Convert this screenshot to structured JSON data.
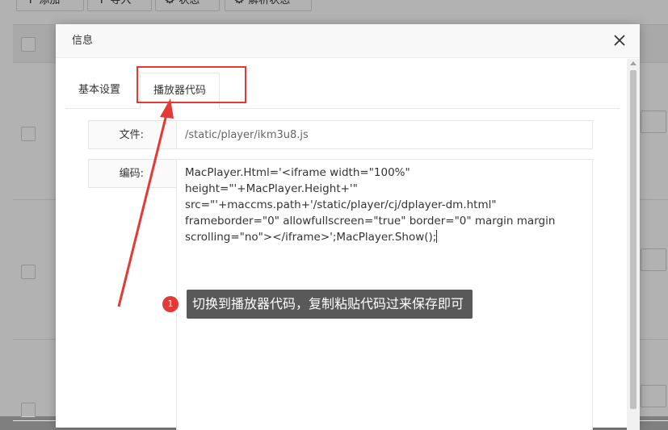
{
  "background": {
    "toolbar": [
      {
        "icon": "plus-icon",
        "label": "添加"
      },
      {
        "icon": "plus-icon",
        "label": "导入"
      },
      {
        "icon": "gear-icon",
        "label": "状态"
      },
      {
        "icon": "gear-icon",
        "label": "解析状态"
      }
    ]
  },
  "modal": {
    "title": "信息",
    "tabs": [
      {
        "label": "基本设置",
        "active": false
      },
      {
        "label": "播放器代码",
        "active": true
      }
    ],
    "fields": {
      "file_label": "文件:",
      "file_value": "/static/player/ikm3u8.js",
      "code_label": "编码:",
      "code_value": "MacPlayer.Html='<iframe width=\"100%\" height=\"'+MacPlayer.Height+'\" src=\"'+maccms.path+'/static/player/cj/dplayer-dm.html\" frameborder=\"0\" allowfullscreen=\"true\" border=\"0\" margin margin scrolling=\"no\"></iframe>';MacPlayer.Show();"
    }
  },
  "annotation": {
    "step_number": "1",
    "text": "切换到播放器代码，复制粘贴代码过来保存即可",
    "color": "#e53935"
  }
}
